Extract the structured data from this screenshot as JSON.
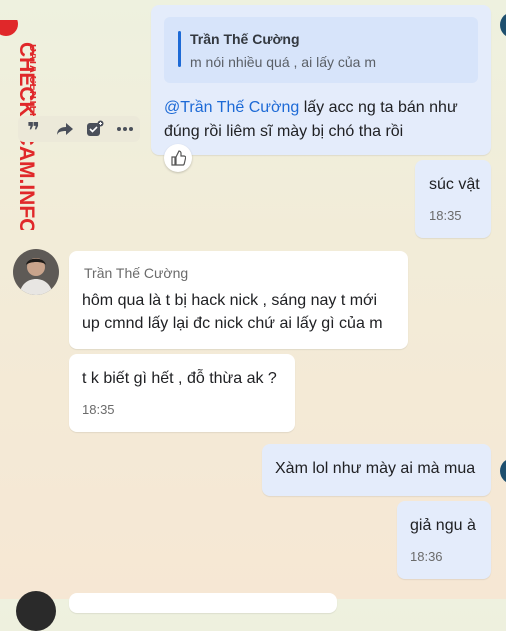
{
  "watermark": {
    "brand": "CHECKSCAM.INFO",
    "sub": "DATA CENTER"
  },
  "colors": {
    "accent": "#1d6ad6",
    "mine_bubble": "#e4ecfb",
    "theirs_bubble": "#ffffff",
    "watermark_red": "#e0282a"
  },
  "messages": [
    {
      "side": "mine",
      "quote": {
        "author": "Trần Thế Cường",
        "text": "m nói nhiều quá , ai lấy của m"
      },
      "mention": "@Trần Thế Cường",
      "line1": " lấy acc ng ta bán như",
      "line2": "đúng rồi liêm sĩ mày bị chó tha rồi",
      "reaction_icon": "thumbs-up-icon"
    },
    {
      "side": "mine",
      "text": "súc vật",
      "time": "18:35"
    },
    {
      "side": "theirs",
      "sender": "Trần Thế Cường",
      "line1": "hôm qua là t bị hack nick , sáng nay t mới",
      "line2": "up cmnd lấy lại đc nick chứ ai lấy gì của m"
    },
    {
      "side": "theirs",
      "text": "t k biết gì hết , đỗ thừa ak ?",
      "time": "18:35"
    },
    {
      "side": "mine",
      "text": "Xàm lol như mày ai mà mua"
    },
    {
      "side": "mine",
      "text": "giả ngu à",
      "time": "18:36"
    }
  ],
  "toolbar": [
    "quote-icon",
    "forward-icon",
    "add-task-icon",
    "more-icon"
  ]
}
